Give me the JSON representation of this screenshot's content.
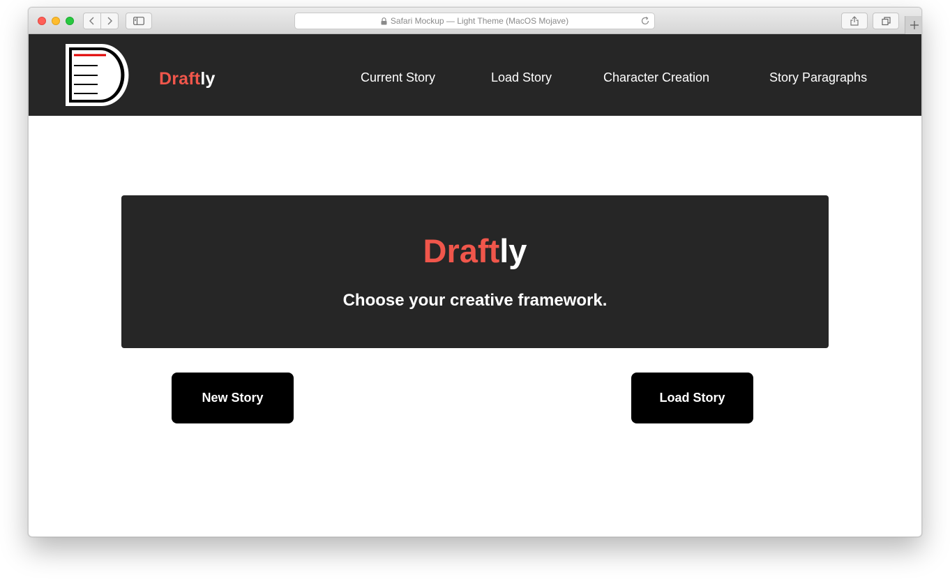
{
  "browser": {
    "address_text": "Safari Mockup — Light Theme (MacOS Mojave)"
  },
  "header": {
    "brand_accent": "Draft",
    "brand_rest": "ly",
    "nav": [
      "Current Story",
      "Load Story",
      "Character Creation",
      "Story Paragraphs"
    ]
  },
  "hero": {
    "title_accent": "Draft",
    "title_rest": "ly",
    "subtitle": "Choose your creative framework."
  },
  "actions": {
    "new_story": "New Story",
    "load_story": "Load Story"
  },
  "colors": {
    "accent": "#f0564b",
    "header_bg": "#262626",
    "button_bg": "#000000"
  },
  "icons": [
    "back-arrow-icon",
    "forward-arrow-icon",
    "sidebar-icon",
    "lock-icon",
    "reload-icon",
    "share-icon",
    "tabs-icon",
    "plus-icon",
    "document-logo-icon"
  ]
}
